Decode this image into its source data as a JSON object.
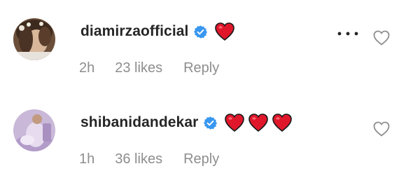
{
  "comments": [
    {
      "username": "diamirzaofficial",
      "time": "2h",
      "likes": "23 likes",
      "reply": "Reply",
      "hearts": 1,
      "icons": {
        "verified": "verified-badge-icon",
        "heart": "red-heart-emoji",
        "more": "more-options-icon",
        "like": "heart-outline-icon"
      }
    },
    {
      "username": "shibanidandekar",
      "time": "1h",
      "likes": "36 likes",
      "reply": "Reply",
      "hearts": 3,
      "icons": {
        "verified": "verified-badge-icon",
        "heart": "red-heart-emoji",
        "like": "heart-outline-icon"
      }
    }
  ],
  "colors": {
    "text": "#262626",
    "secondary": "#8e8e8e",
    "verified": "#3897f0",
    "heart": "#e0172b"
  }
}
